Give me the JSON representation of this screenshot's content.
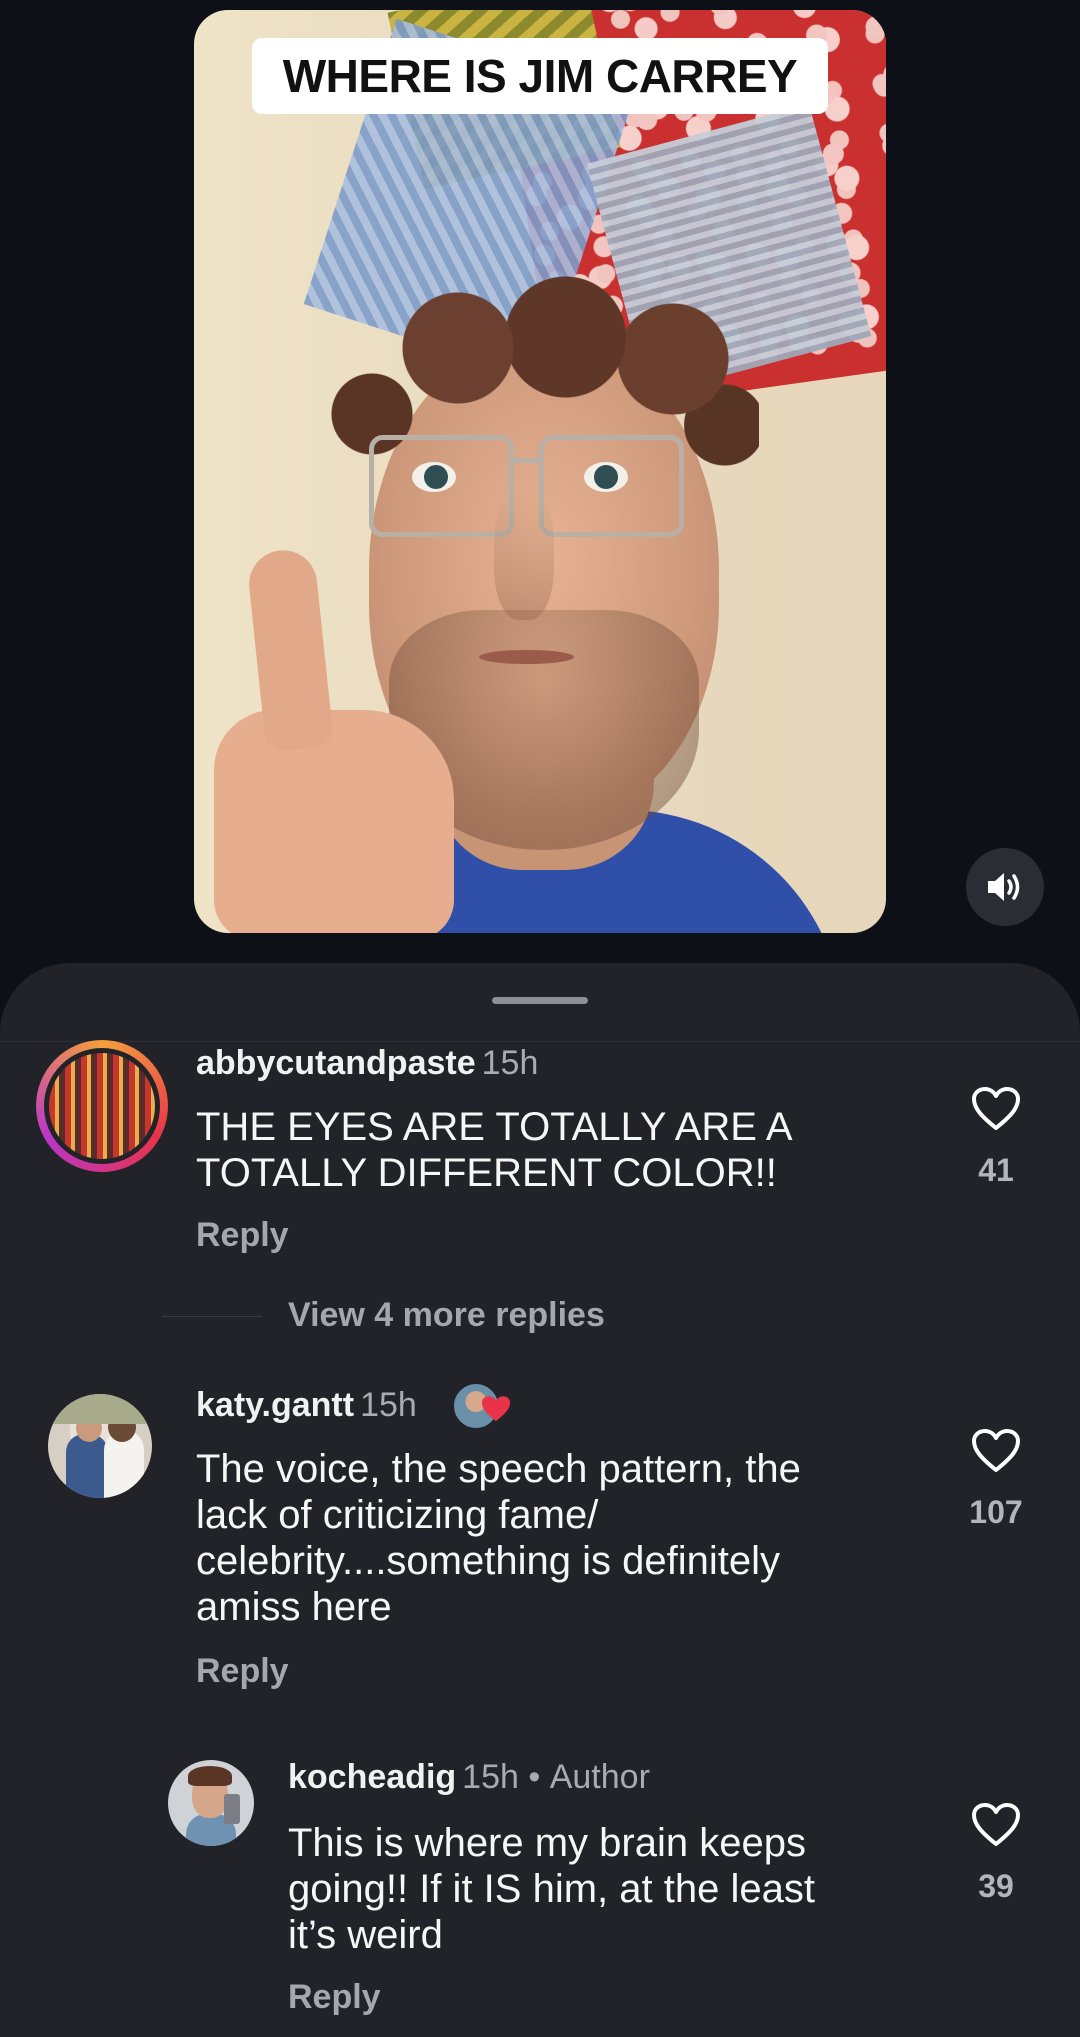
{
  "video": {
    "overlay_title": "WHERE IS JIM CARREY",
    "mute_icon": "speaker-icon"
  },
  "comments": [
    {
      "username": "abbycutandpaste",
      "time": "15h",
      "text_lines": [
        "THE EYES ARE TOTALLY ARE A",
        "TOTALLY DIFFERENT COLOR!!"
      ],
      "reply_label": "Reply",
      "likes": "41",
      "view_more": "View 4 more replies"
    },
    {
      "username": "katy.gantt",
      "time": "15h",
      "text_lines": [
        "The voice, the speech pattern, the",
        "lack of criticizing fame/",
        "celebrity....something is definitely",
        "amiss here"
      ],
      "reply_label": "Reply",
      "likes": "107"
    },
    {
      "username": "kocheadig",
      "time": "15h",
      "author_tag": "Author",
      "separator": "•",
      "text_lines": [
        "This is where my brain keeps",
        "going!! If it IS him, at the least",
        "it’s weird"
      ],
      "reply_label": "Reply",
      "likes": "39"
    }
  ],
  "colors": {
    "background": "#0d1117",
    "sheet": "#212328",
    "muted_text": "#a5a7ad",
    "creator_heart": "#e8334a"
  }
}
